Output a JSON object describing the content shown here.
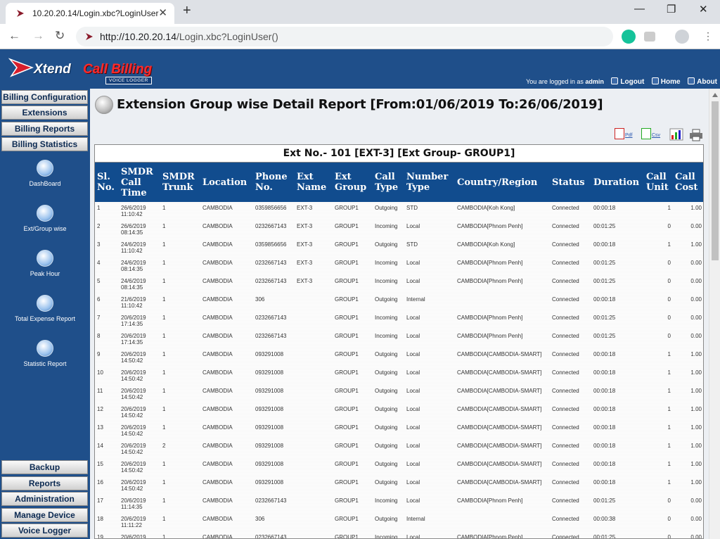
{
  "browser": {
    "tab_title": "10.20.20.14/Login.xbc?LoginUser()",
    "url_host": "http://10.20.20.14",
    "url_path": "/Login.xbc?LoginUser()"
  },
  "header": {
    "logo_word1": "Xtend",
    "logo_word2": "Call Billing",
    "logo_tag": "VOICE LOGGER",
    "logged_prefix": "You are logged in as",
    "user": "admin",
    "logout": "Logout",
    "home": "Home",
    "about": "About"
  },
  "sidebar": {
    "top_buttons": [
      "Billing Configuration",
      "Extensions",
      "Billing Reports",
      "Billing Statistics"
    ],
    "icons": [
      "DashBoard",
      "Ext/Group wise",
      "Peak Hour",
      "Total Expense Report",
      "Statistic Report"
    ],
    "bottom_buttons": [
      "Backup",
      "Reports",
      "Administration",
      "Manage Device",
      "Voice Logger"
    ]
  },
  "report": {
    "title": "Extension Group wise Detail Report [From:01/06/2019 To:26/06/2019]",
    "export_pdf": "Pdf",
    "export_csv": "Csv",
    "group_caption": "Ext No.- 101 [EXT-3] [Ext Group- GROUP1]",
    "columns": [
      "Sl. No.",
      "SMDR Call Time",
      "SMDR Trunk",
      "Location",
      "Phone No.",
      "Ext Name",
      "Ext Group",
      "Call Type",
      "Number Type",
      "Country/Region",
      "Status",
      "Duration",
      "Call Unit",
      "Call Cost"
    ],
    "rows": [
      [
        "1",
        "26/6/2019 11:10:42",
        "1",
        "CAMBODIA",
        "0359856656",
        "EXT-3",
        "GROUP1",
        "Outgoing",
        "STD",
        "CAMBODIA[Koh Kong]",
        "Connected",
        "00:00:18",
        "1",
        "1.00"
      ],
      [
        "2",
        "26/6/2019 08:14:35",
        "1",
        "CAMBODIA",
        "0232667143",
        "EXT-3",
        "GROUP1",
        "Incoming",
        "Local",
        "CAMBODIA[Phnom Penh]",
        "Connected",
        "00:01:25",
        "0",
        "0.00"
      ],
      [
        "3",
        "24/6/2019 11:10:42",
        "1",
        "CAMBODIA",
        "0359856656",
        "EXT-3",
        "GROUP1",
        "Outgoing",
        "STD",
        "CAMBODIA[Koh Kong]",
        "Connected",
        "00:00:18",
        "1",
        "1.00"
      ],
      [
        "4",
        "24/6/2019 08:14:35",
        "1",
        "CAMBODIA",
        "0232667143",
        "EXT-3",
        "GROUP1",
        "Incoming",
        "Local",
        "CAMBODIA[Phnom Penh]",
        "Connected",
        "00:01:25",
        "0",
        "0.00"
      ],
      [
        "5",
        "24/6/2019 08:14:35",
        "1",
        "CAMBODIA",
        "0232667143",
        "EXT-3",
        "GROUP1",
        "Incoming",
        "Local",
        "CAMBODIA[Phnom Penh]",
        "Connected",
        "00:01:25",
        "0",
        "0.00"
      ],
      [
        "6",
        "21/6/2019 11:10:42",
        "1",
        "CAMBODIA",
        "306",
        "",
        "GROUP1",
        "Outgoing",
        "Internal",
        "",
        "Connected",
        "00:00:18",
        "0",
        "0.00"
      ],
      [
        "7",
        "20/6/2019 17:14:35",
        "1",
        "CAMBODIA",
        "0232667143",
        "",
        "GROUP1",
        "Incoming",
        "Local",
        "CAMBODIA[Phnom Penh]",
        "Connected",
        "00:01:25",
        "0",
        "0.00"
      ],
      [
        "8",
        "20/6/2019 17:14:35",
        "1",
        "CAMBODIA",
        "0232667143",
        "",
        "GROUP1",
        "Incoming",
        "Local",
        "CAMBODIA[Phnom Penh]",
        "Connected",
        "00:01:25",
        "0",
        "0.00"
      ],
      [
        "9",
        "20/6/2019 14:50:42",
        "1",
        "CAMBODIA",
        "093291008",
        "",
        "GROUP1",
        "Outgoing",
        "Local",
        "CAMBODIA[CAMBODIA-SMART]",
        "Connected",
        "00:00:18",
        "1",
        "1.00"
      ],
      [
        "10",
        "20/6/2019 14:50:42",
        "1",
        "CAMBODIA",
        "093291008",
        "",
        "GROUP1",
        "Outgoing",
        "Local",
        "CAMBODIA[CAMBODIA-SMART]",
        "Connected",
        "00:00:18",
        "1",
        "1.00"
      ],
      [
        "11",
        "20/6/2019 14:50:42",
        "1",
        "CAMBODIA",
        "093291008",
        "",
        "GROUP1",
        "Outgoing",
        "Local",
        "CAMBODIA[CAMBODIA-SMART]",
        "Connected",
        "00:00:18",
        "1",
        "1.00"
      ],
      [
        "12",
        "20/6/2019 14:50:42",
        "1",
        "CAMBODIA",
        "093291008",
        "",
        "GROUP1",
        "Outgoing",
        "Local",
        "CAMBODIA[CAMBODIA-SMART]",
        "Connected",
        "00:00:18",
        "1",
        "1.00"
      ],
      [
        "13",
        "20/6/2019 14:50:42",
        "1",
        "CAMBODIA",
        "093291008",
        "",
        "GROUP1",
        "Outgoing",
        "Local",
        "CAMBODIA[CAMBODIA-SMART]",
        "Connected",
        "00:00:18",
        "1",
        "1.00"
      ],
      [
        "14",
        "20/6/2019 14:50:42",
        "2",
        "CAMBODIA",
        "093291008",
        "",
        "GROUP1",
        "Outgoing",
        "Local",
        "CAMBODIA[CAMBODIA-SMART]",
        "Connected",
        "00:00:18",
        "1",
        "1.00"
      ],
      [
        "15",
        "20/6/2019 14:50:42",
        "1",
        "CAMBODIA",
        "093291008",
        "",
        "GROUP1",
        "Outgoing",
        "Local",
        "CAMBODIA[CAMBODIA-SMART]",
        "Connected",
        "00:00:18",
        "1",
        "1.00"
      ],
      [
        "16",
        "20/6/2019 14:50:42",
        "1",
        "CAMBODIA",
        "093291008",
        "",
        "GROUP1",
        "Outgoing",
        "Local",
        "CAMBODIA[CAMBODIA-SMART]",
        "Connected",
        "00:00:18",
        "1",
        "1.00"
      ],
      [
        "17",
        "20/6/2019 11:14:35",
        "1",
        "CAMBODIA",
        "0232667143",
        "",
        "GROUP1",
        "Incoming",
        "Local",
        "CAMBODIA[Phnom Penh]",
        "Connected",
        "00:01:25",
        "0",
        "0.00"
      ],
      [
        "18",
        "20/6/2019 11:11:22",
        "1",
        "CAMBODIA",
        "306",
        "",
        "GROUP1",
        "Outgoing",
        "Internal",
        "",
        "Connected",
        "00:00:38",
        "0",
        "0.00"
      ],
      [
        "19",
        "20/6/2019",
        "1",
        "CAMBODIA",
        "0232667143",
        "",
        "GROUP1",
        "Incoming",
        "Local",
        "CAMBODIA[Phnom Penh]",
        "Connected",
        "00:01:25",
        "0",
        "0.00"
      ]
    ]
  },
  "colors": {
    "header_blue": "#1f4f8a",
    "table_header": "#114c8e",
    "accent_red": "#ff2a2a"
  }
}
